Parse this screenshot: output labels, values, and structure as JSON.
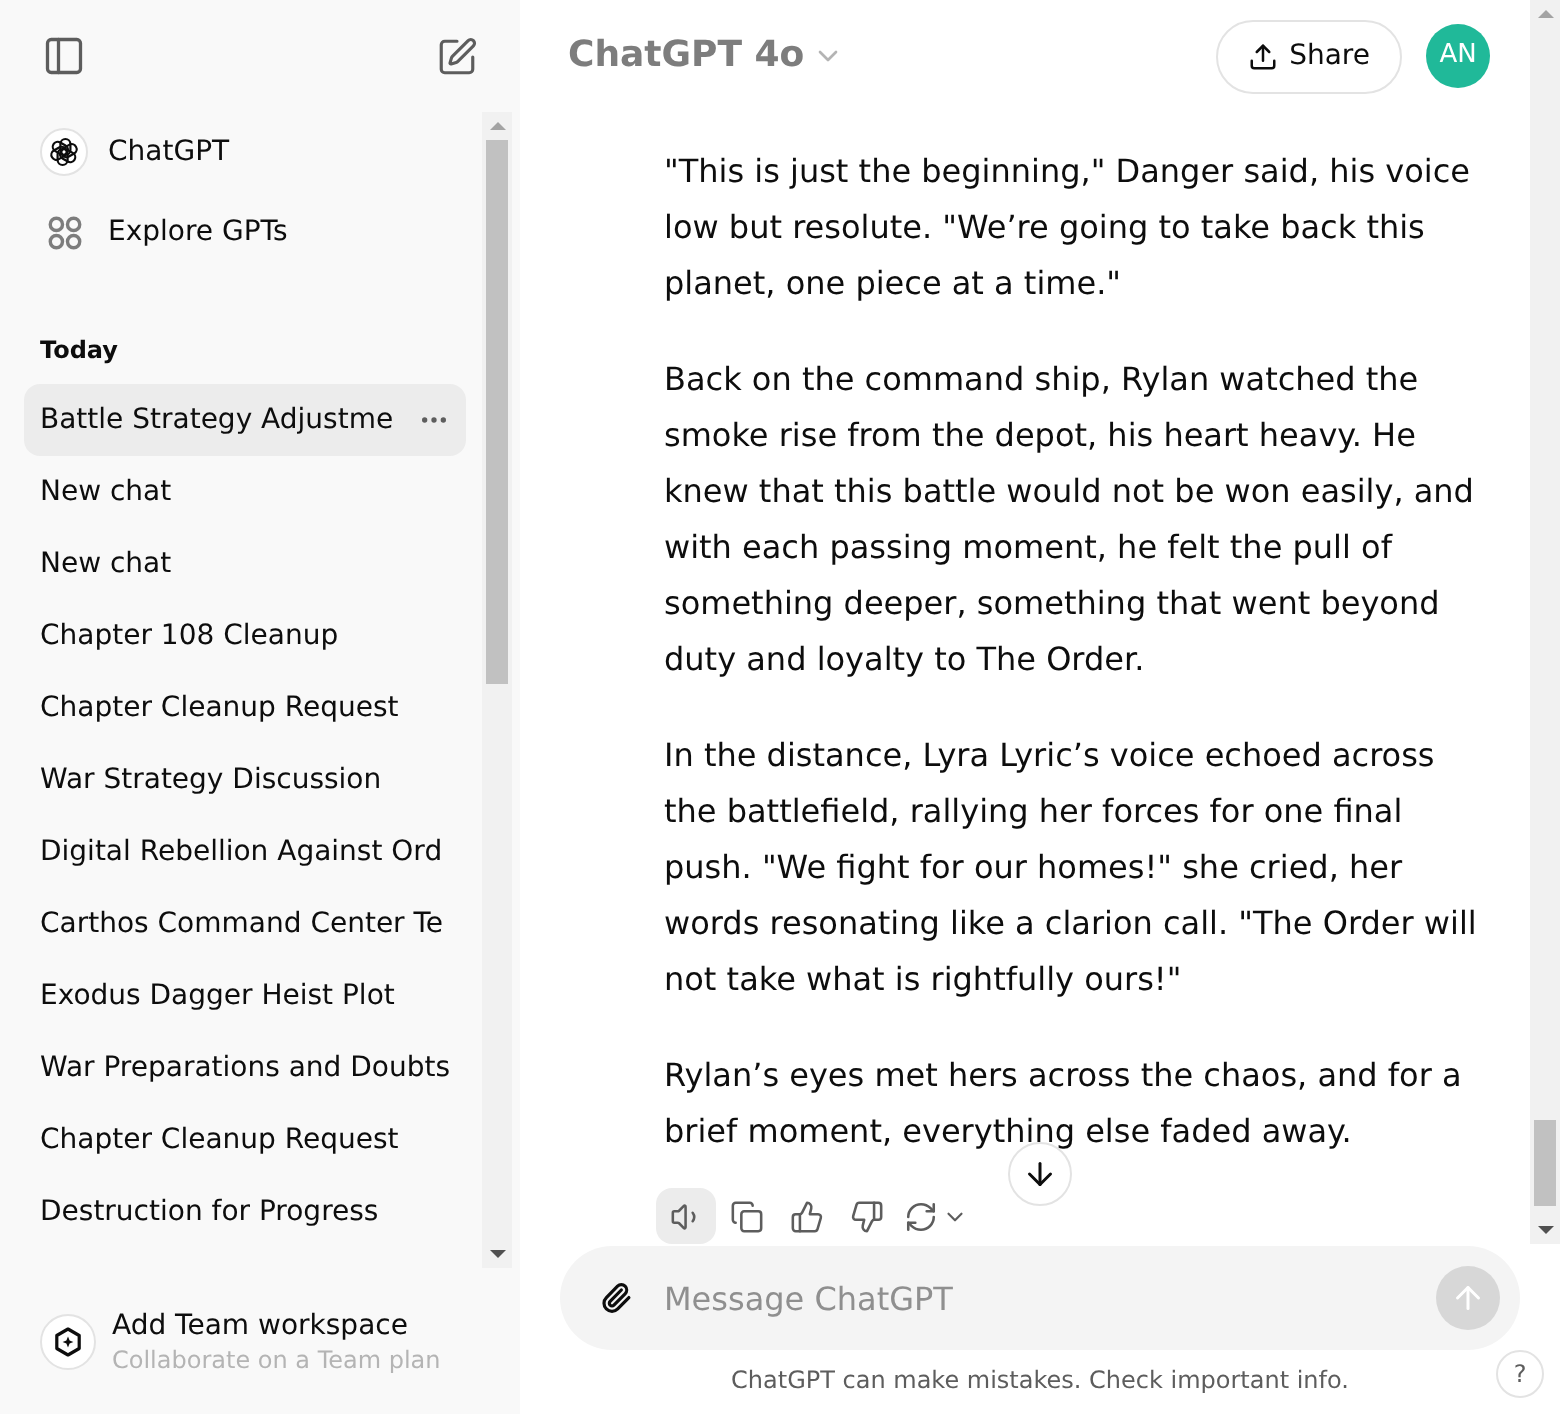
{
  "sidebar": {
    "nav_links": [
      {
        "kind": "chatgpt",
        "label": "ChatGPT"
      },
      {
        "kind": "explore",
        "label": "Explore GPTs"
      }
    ],
    "section_label": "Today",
    "chats": [
      {
        "title": "Battle Strategy Adjustme",
        "selected": true
      },
      {
        "title": "New chat",
        "selected": false
      },
      {
        "title": "New chat",
        "selected": false
      },
      {
        "title": "Chapter 108 Cleanup",
        "selected": false
      },
      {
        "title": "Chapter Cleanup Request",
        "selected": false
      },
      {
        "title": "War Strategy Discussion",
        "selected": false
      },
      {
        "title": "Digital Rebellion Against Ord",
        "selected": false
      },
      {
        "title": "Carthos Command Center Te",
        "selected": false
      },
      {
        "title": "Exodus Dagger Heist Plot",
        "selected": false
      },
      {
        "title": "War Preparations and Doubts",
        "selected": false
      },
      {
        "title": "Chapter Cleanup Request",
        "selected": false
      },
      {
        "title": "Destruction for Progress",
        "selected": false
      }
    ],
    "team_workspace": {
      "title": "Add Team workspace",
      "subtitle": "Collaborate on a Team plan"
    }
  },
  "header": {
    "model": "ChatGPT 4o",
    "share": "Share",
    "avatar": "AN"
  },
  "conversation": {
    "paragraphs": [
      "\"This is just the beginning,\" Danger said, his voice low but resolute. \"We’re going to take back this planet, one piece at a time.\"",
      "Back on the command ship, Rylan watched the smoke rise from the depot, his heart heavy. He knew that this battle would not be won easily, and with each passing moment, he felt the pull of something deeper, something that went beyond duty and loyalty to The Order.",
      "In the distance, Lyra Lyric’s voice echoed across the battlefield, rallying her forces for one final push. \"We fight for our homes!\" she cried, her words resonating like a clarion call. \"The Order will not take what is rightfully ours!\"",
      "Rylan’s eyes met hers across the chaos, and for a brief moment, everything else faded away."
    ],
    "actions": [
      {
        "kind": "read_aloud",
        "highlighted": true
      },
      {
        "kind": "copy",
        "highlighted": false
      },
      {
        "kind": "thumbs_up",
        "highlighted": false
      },
      {
        "kind": "thumbs_down",
        "highlighted": false
      },
      {
        "kind": "regenerate",
        "highlighted": false
      }
    ]
  },
  "composer": {
    "placeholder": "Message ChatGPT",
    "send_disabled": true
  },
  "disclaimer": "ChatGPT can make mistakes. Check important info.",
  "help": "?"
}
